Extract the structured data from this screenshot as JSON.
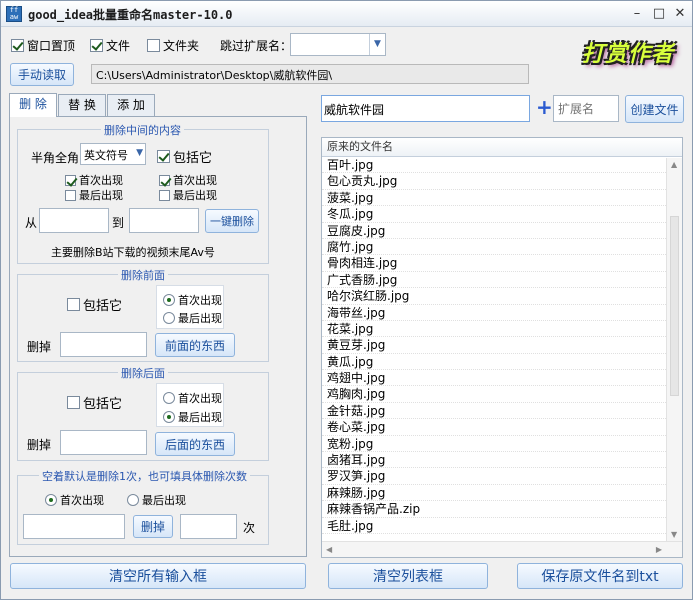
{
  "window": {
    "title": "good_idea批量重命名master-10.0",
    "icon_text": "ff aw"
  },
  "toolbar": {
    "top_window_label": "窗口置顶",
    "top_window_checked": true,
    "file_label": "文件",
    "file_checked": true,
    "folder_label": "文件夹",
    "folder_checked": false,
    "skip_ext_label": "跳过扩展名：",
    "skip_ext_value": "",
    "manual_read_label": "手动读取",
    "path_value": "C:\\Users\\Administrator\\Desktop\\威航软件园\\",
    "logo_text": "打赏作者"
  },
  "tabs": [
    {
      "label": "删 除",
      "active": true
    },
    {
      "label": "替 换",
      "active": false
    },
    {
      "label": "添 加",
      "active": false
    }
  ],
  "delete_middle": {
    "title": "删除中间的内容",
    "halfwidth_label": "半角全角",
    "symbol_select": "英文符号",
    "include_label": "包括它",
    "include_checked": true,
    "left_first_label": "首次出现",
    "left_first_checked": true,
    "left_last_label": "最后出现",
    "left_last_checked": false,
    "right_first_label": "首次出现",
    "right_first_checked": true,
    "right_last_label": "最后出现",
    "right_last_checked": false,
    "from_label": "从",
    "to_label": "到",
    "one_click_delete_label": "一键删除",
    "hint": "主要删除B站下载的视频末尾Av号"
  },
  "delete_front": {
    "title": "删除前面",
    "include_label": "包括它",
    "first_label": "首次出现",
    "last_label": "最后出现",
    "delete_label": "删掉",
    "button_label": "前面的东西"
  },
  "delete_back": {
    "title": "删除后面",
    "include_label": "包括它",
    "first_label": "首次出现",
    "last_label": "最后出现",
    "delete_label": "删掉",
    "button_label": "后面的东西"
  },
  "delete_count": {
    "title": "空着默认是删除1次，也可填具体删除次数",
    "first_label": "首次出现",
    "last_label": "最后出现",
    "delete_button_label": "删掉",
    "times_label": "次"
  },
  "right_panel": {
    "folder_name_value": "威航软件园",
    "ext_placeholder": "扩展名",
    "create_file_label": "创建文件",
    "list_header": "原来的文件名",
    "files": [
      "百叶.jpg",
      "包心贡丸.jpg",
      "菠菜.jpg",
      "冬瓜.jpg",
      "豆腐皮.jpg",
      "腐竹.jpg",
      "骨肉相连.jpg",
      "广式香肠.jpg",
      "哈尔滨红肠.jpg",
      "海带丝.jpg",
      "花菜.jpg",
      "黄豆芽.jpg",
      "黄瓜.jpg",
      "鸡翅中.jpg",
      "鸡胸肉.jpg",
      "金针菇.jpg",
      "卷心菜.jpg",
      "宽粉.jpg",
      "卤猪耳.jpg",
      "罗汉笋.jpg",
      "麻辣肠.jpg",
      "麻辣香锅产品.zip",
      "毛肚.jpg"
    ]
  },
  "bottom": {
    "clear_inputs_label": "清空所有输入框",
    "clear_list_label": "清空列表框",
    "save_txt_label": "保存原文件名到txt"
  }
}
